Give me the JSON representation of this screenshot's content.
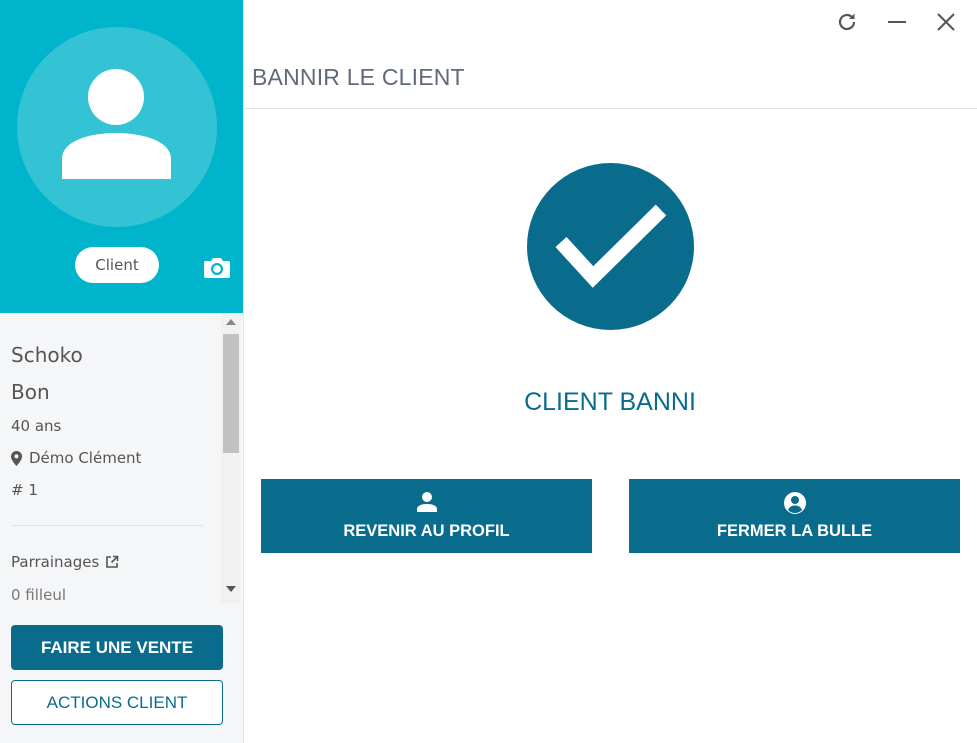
{
  "colors": {
    "sidebar_header_bg": "#00b5cb",
    "primary": "#0a6c8c",
    "title_text": "#606a78"
  },
  "window_controls": {
    "refresh_icon": "refresh-icon",
    "minimize_icon": "minimize-icon",
    "close_icon": "close-icon"
  },
  "sidebar": {
    "avatar_icon": "person-icon",
    "role_badge": "Client",
    "camera_icon": "camera-icon",
    "client": {
      "first_name": "Schoko",
      "last_name": "Bon",
      "age": "40 ans",
      "location": "Démo Clément",
      "id": "# 1"
    },
    "parrainages_label": "Parrainages",
    "filleul": "0 filleul",
    "sale_button": "FAIRE UNE VENTE",
    "actions_button": "ACTIONS CLIENT"
  },
  "main": {
    "title": "BANNIR LE CLIENT",
    "status_icon": "check-circle-icon",
    "status_text": "CLIENT BANNI",
    "buttons": [
      {
        "label": "REVENIR AU PROFIL",
        "icon": "person-icon"
      },
      {
        "label": "FERMER LA BULLE",
        "icon": "account-circle-icon"
      }
    ]
  }
}
